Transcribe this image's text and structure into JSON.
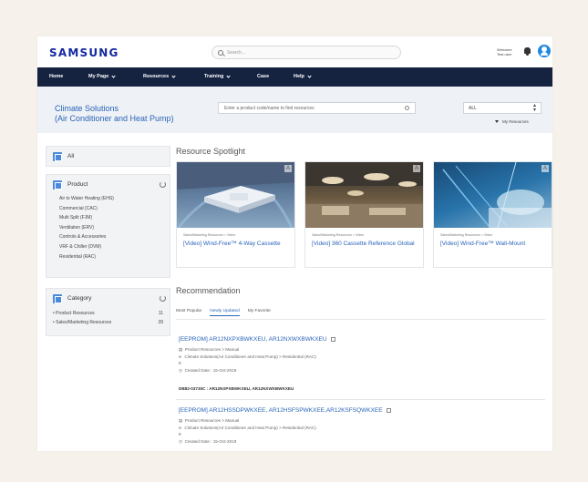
{
  "header": {
    "logo": "SAMSUNG",
    "search_placeholder": "Search...",
    "welcome_line1": "Welcome",
    "welcome_line2": "Test user"
  },
  "nav": {
    "items": [
      {
        "label": "Home",
        "has_caret": false
      },
      {
        "label": "My Page",
        "has_caret": true
      },
      {
        "label": "Resources",
        "has_caret": true
      },
      {
        "label": "Training",
        "has_caret": true
      },
      {
        "label": "Case",
        "has_caret": false
      },
      {
        "label": "Help",
        "has_caret": true
      }
    ]
  },
  "band": {
    "title_line1": "Climate Solutions",
    "title_line2": "(Air Conditioner and Heat Pump)",
    "product_search_placeholder": "Enter a product code/name to find resources",
    "filter_value": "ALL",
    "my_resources": "My Resources"
  },
  "sidebar": {
    "all_label": "All",
    "product": {
      "title": "Product",
      "items": [
        "Air to Water Heating (EHS)",
        "Commercial (CAC)",
        "Multi Split (FJM)",
        "Ventilation (ERV)",
        "Controls & Accessories",
        "VRF & Chiller (DVM)",
        "Residential (RAC)"
      ]
    },
    "category": {
      "title": "Category",
      "items": [
        {
          "label": "• Product Resources",
          "count": "11"
        },
        {
          "label": "• Sales/Marketing Resources",
          "count": "39"
        }
      ]
    }
  },
  "spotlight": {
    "title": "Resource Spotlight",
    "cards": [
      {
        "meta": "Sales/Marketing Resources > Video",
        "title": "[Video] Wind-Free™ 4-Way Cassette"
      },
      {
        "meta": "Sales/Marketing Resources > Video",
        "title": "[Video] 360 Cassette Reference Global"
      },
      {
        "meta": "Sales/Marketing Resources > Video",
        "title": "[Video] Wind-Free™ Wall-Mount"
      }
    ]
  },
  "recommendation": {
    "title": "Recommendation",
    "tabs": [
      "Most Popular",
      "Newly Updated",
      "My Favorite"
    ],
    "active_tab": 1,
    "items": [
      {
        "title": "[EEPROM] AR12NXPXBWKXEU, AR12NXWXBWKXEU",
        "type": "Product Resources > Manual",
        "product": "Climate Solutions(Air Conditioner and Heat Pump) > Residential (RAC)",
        "extra": "8",
        "created": "Created Date : 15-Oct-2019",
        "code": "DB82-03730C : AR12NXPXBWKXEU, AR12NXWXBWKXEU"
      },
      {
        "title": "[EEPROM] AR12HSSDPWKXEE, AR12HSFSPWKXEE,AR12KSFSQWKXEE",
        "type": "Product Resources > Manual",
        "product": "Climate Solutions(Air Conditioner and Heat Pump) > Residential (RAC)",
        "extra": "8",
        "created": "Created Date : 15-Oct-2019"
      }
    ]
  },
  "colors": {
    "brand": "#1428a0",
    "nav_bg": "#152341",
    "link": "#2a64b8"
  }
}
